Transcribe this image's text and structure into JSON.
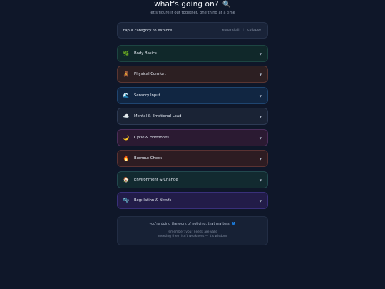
{
  "header": {
    "title": "what's going on?",
    "title_icon": "magnifier-icon",
    "title_glyph": "🔍",
    "subtitle": "let's figure it out together, one thing at a time"
  },
  "explore": {
    "label": "tap a category to explore",
    "expand_all": "expand all",
    "separator": "|",
    "collapse": "collapse"
  },
  "categories": [
    {
      "label": "Body Basics",
      "icon": "herb-icon",
      "glyph": "🌿",
      "chevron": "▼"
    },
    {
      "label": "Physical Comfort",
      "icon": "teddy-bear-icon",
      "glyph": "🧸",
      "chevron": "▼"
    },
    {
      "label": "Sensory Input",
      "icon": "wave-icon",
      "glyph": "🌊",
      "chevron": "▼"
    },
    {
      "label": "Mental & Emotional Load",
      "icon": "cloud-icon",
      "glyph": "☁️",
      "chevron": "▼"
    },
    {
      "label": "Cycle & Hormones",
      "icon": "crescent-moon-icon",
      "glyph": "🌙",
      "chevron": "▼"
    },
    {
      "label": "Burnout Check",
      "icon": "fire-icon",
      "glyph": "🔥",
      "chevron": "▼"
    },
    {
      "label": "Environment & Change",
      "icon": "house-icon",
      "glyph": "🏠",
      "chevron": "▼"
    },
    {
      "label": "Regulation & Needs",
      "icon": "bubbles-icon",
      "glyph": "🫧",
      "chevron": "▼"
    }
  ],
  "footer": {
    "message": "you're doing the work of noticing. that matters.",
    "heart_icon": "blue-heart-icon",
    "heart_glyph": "💙",
    "line1": "remember: your needs are valid",
    "line2": "meeting them isn't weakness — it's wisdom"
  },
  "colors": {
    "background": "#0f1729",
    "accent_heart": "#4aa3ff"
  }
}
